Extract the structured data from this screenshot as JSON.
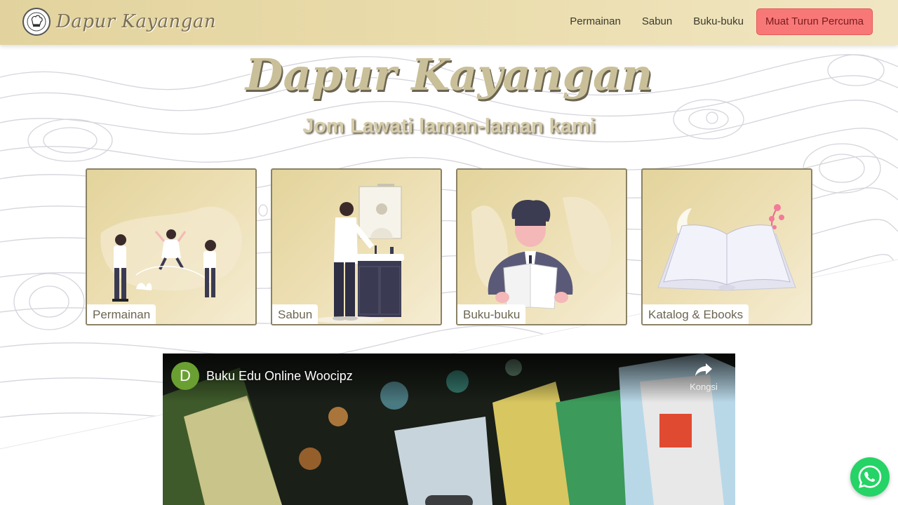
{
  "brand": {
    "name": "Dapur Kayangan",
    "logo_icon": "chef-logo-icon"
  },
  "nav": {
    "links": [
      "Permainan",
      "Sabun",
      "Buku-buku"
    ],
    "cta_label": "Muat Turun Percuma"
  },
  "hero": {
    "title": "Dapur Kayangan",
    "subtitle": "Jom Lawati laman-laman kami"
  },
  "cards": [
    {
      "label": "Permainan",
      "icon": "children-playing-illustration"
    },
    {
      "label": "Sabun",
      "icon": "man-washing-hands-illustration"
    },
    {
      "label": "Buku-buku",
      "icon": "man-reading-book-illustration"
    },
    {
      "label": "Katalog & Ebooks",
      "icon": "open-book-illustration"
    }
  ],
  "video": {
    "avatar_letter": "D",
    "title": "Buku Edu Online Woocipz",
    "share_label": "Kongsi"
  },
  "colors": {
    "navbar": "#e2d39e",
    "cta_bg": "#f87878",
    "card_border": "#8b8266",
    "whatsapp": "#25d366"
  }
}
